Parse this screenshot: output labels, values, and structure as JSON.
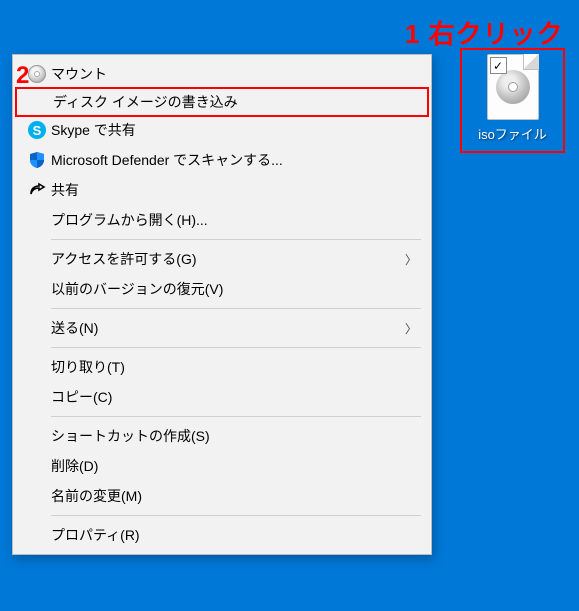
{
  "callouts": {
    "one": "1 右クリック",
    "two": "2"
  },
  "desktop": {
    "file_label": "isoファイル",
    "checkmark": "✓"
  },
  "menu": {
    "mount": "マウント",
    "burn_disc_image": "ディスク イメージの書き込み",
    "skype_share": "Skype で共有",
    "defender_scan": "Microsoft Defender でスキャンする...",
    "share": "共有",
    "open_with": "プログラムから開く(H)...",
    "give_access": "アクセスを許可する(G)",
    "restore_versions": "以前のバージョンの復元(V)",
    "send_to": "送る(N)",
    "cut": "切り取り(T)",
    "copy": "コピー(C)",
    "create_shortcut": "ショートカットの作成(S)",
    "delete": "削除(D)",
    "rename": "名前の変更(M)",
    "properties": "プロパティ(R)"
  },
  "icons": {
    "skype_letter": "S"
  }
}
